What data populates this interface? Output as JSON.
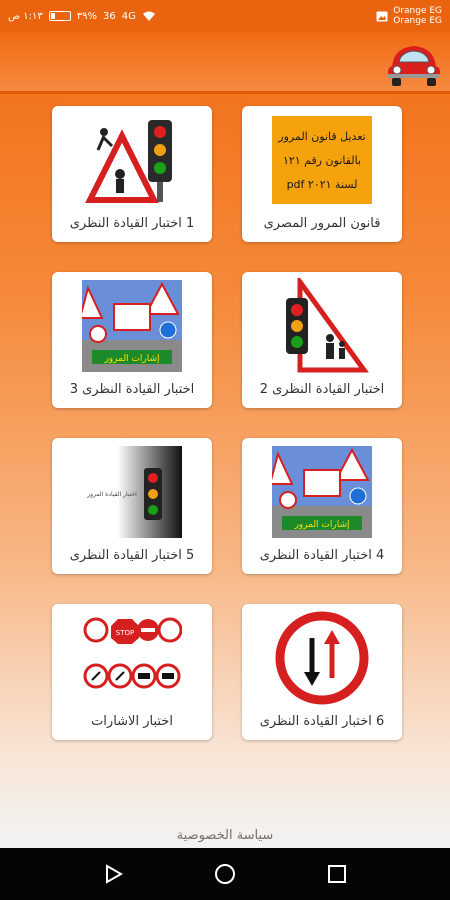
{
  "status": {
    "time": "١:١٣ ص",
    "signal_1": "36",
    "signal_2": "4G",
    "battery": "٣٩%",
    "carrier_1": "Orange EG",
    "carrier_2": "Orange EG"
  },
  "app_bar": {
    "logo_icon": "red-beetle-car-icon"
  },
  "cards": [
    {
      "label": "قانون المرور المصرى",
      "thumb_lines": [
        "تعديل قانون المرور",
        "بالقانون رقم ١٢١",
        "لسنة ٢٠٢١ pdf"
      ]
    },
    {
      "label": "1 اختبار القيادة النظرى"
    },
    {
      "label": "اختبار القيادة النظرى 2"
    },
    {
      "label": "اختبار القيادة النظرى 3",
      "thumb_caption": "إشارات المرور"
    },
    {
      "label": "4 اختبار القيادة النظرى",
      "thumb_caption": "إشارات المرور"
    },
    {
      "label": "5 اختبار القيادة النظرى",
      "thumb_caption": "اختبار القيادة المرور"
    },
    {
      "label": "6 اختبار القيادة النظرى"
    },
    {
      "label": "اختبار الاشارات",
      "thumb_caption": "STOP"
    }
  ],
  "footer": {
    "privacy": "سياسة الخصوصية"
  },
  "nav": {
    "back": "back-icon",
    "home": "home-icon",
    "recents": "recents-icon"
  }
}
